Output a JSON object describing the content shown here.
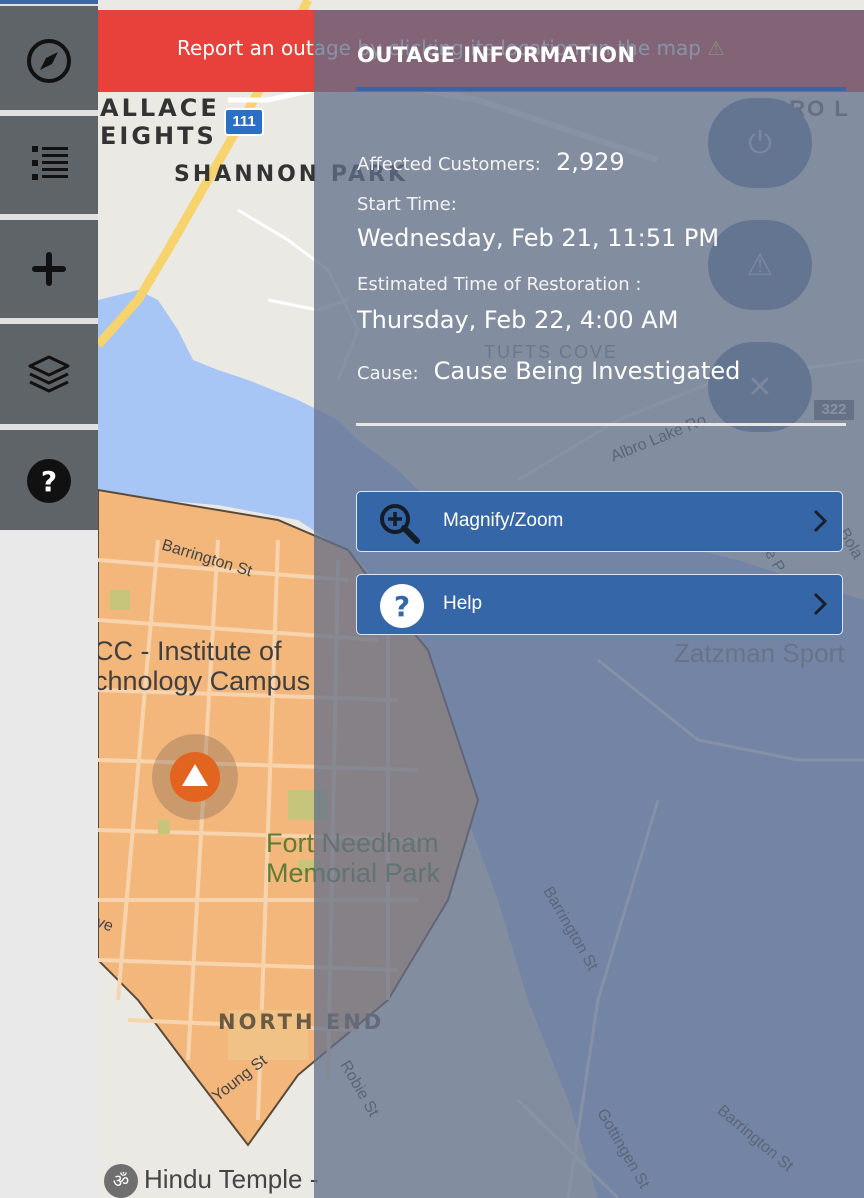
{
  "banner": {
    "text": "Report an outage by clicking its location on the map",
    "warning_icon": "warning-icon"
  },
  "map": {
    "labels": {
      "wallace_heights_1": "ALLACE",
      "wallace_heights_2": "EIGHTS",
      "shannon_park": "SHANNON PARK",
      "highway_111": "111",
      "highway_322": "322",
      "albro_lake_top": "ALBRO L",
      "tufts_cove": "TUFTS COVE",
      "albro_lake_road": "Albro Lake Ro",
      "barrington_st_1": "Barrington St",
      "barrington_st_2": "Barrington St",
      "barrington_st_3": "Barrington St",
      "campus_1": "CC - Institute of",
      "campus_2": "chnology Campus",
      "park_1": "Fort Needham",
      "park_2": "Memorial Park",
      "north_end": "NORTH END",
      "young_st": "Young St",
      "robie_st": "Robie St",
      "gottingen_st": "Gottingen St",
      "zatzman": "Zatzman Sport",
      "edge_ve": "ve",
      "hindu_temple": "Hindu Temple -",
      "bola": "Bola",
      "edge_e": "e P"
    },
    "colors": {
      "water": "#a7c5f5",
      "land": "#ebe9e4",
      "outage_area": "#f3b77b",
      "highway": "#f6d36c",
      "marker": "#e2641f"
    }
  },
  "panel": {
    "title": "OUTAGE INFORMATION",
    "affected_label": "Affected Customers:",
    "affected_value": "2,929",
    "start_label": "Start Time:",
    "start_value": "Wednesday, Feb 21, 11:51 PM",
    "etr_label": "Estimated Time of Restoration :",
    "etr_value": "Thursday, Feb 22, 4:00 AM",
    "cause_label": "Cause:",
    "cause_value": "Cause Being Investigated",
    "actions": [
      {
        "label": "Magnify/Zoom",
        "icon": "magnify-icon"
      },
      {
        "label": "Help",
        "icon": "help-circle-icon"
      }
    ]
  },
  "sidebar": {
    "items": [
      {
        "icon": "compass-icon"
      },
      {
        "icon": "list-icon"
      },
      {
        "icon": "plus-icon"
      },
      {
        "icon": "layers-icon"
      },
      {
        "icon": "help-icon"
      }
    ]
  },
  "fabs": [
    {
      "icon": "power-icon"
    },
    {
      "icon": "warning-icon"
    },
    {
      "icon": "close-icon"
    }
  ]
}
